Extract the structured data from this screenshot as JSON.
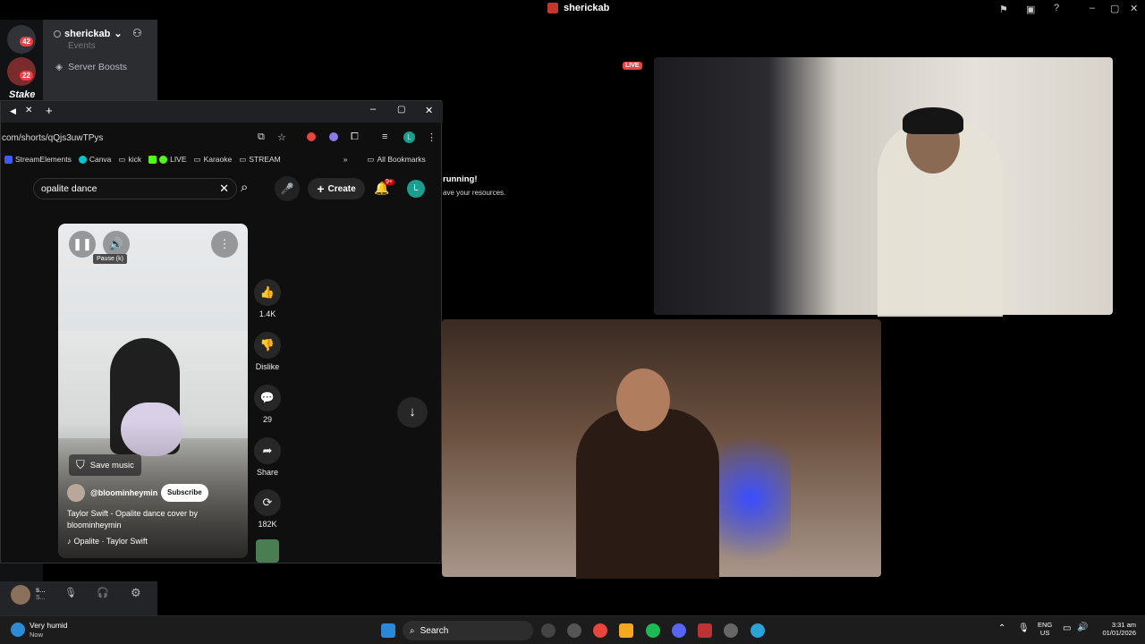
{
  "window": {
    "title": "sherickab"
  },
  "discord": {
    "server_badges": [
      "42",
      "22"
    ],
    "server_logo_text": "Stake",
    "user_name": "sherickab",
    "channels": [
      "Events",
      "Server Boosts"
    ],
    "live_badge": "LIVE",
    "notice_title": "running!",
    "notice_text": "ave your resources.",
    "user_panel": {
      "name": "s...",
      "status": "S..."
    }
  },
  "browser": {
    "url": "com/shorts/qQjs3uwTPys",
    "bookmarks": [
      {
        "label": "StreamElements",
        "color": "#3d5afe"
      },
      {
        "label": "Canva",
        "color": "#00c4cc"
      },
      {
        "label": "kick",
        "color": "#888888"
      },
      {
        "label": "LIVE",
        "color": "#53fc18"
      },
      {
        "label": "Karaoke",
        "color": "#888888"
      },
      {
        "label": "STREAM",
        "color": "#888888"
      }
    ],
    "all_bookmarks": "All Bookmarks",
    "profile_initial": "L"
  },
  "youtube": {
    "search_value": "opalite dance",
    "create_label": "Create",
    "notif_badge": "9+",
    "avatar_initial": "L",
    "tooltip": "Pause (k)",
    "save_music": "Save music",
    "channel": "@bloominheymin",
    "subscribe": "Subscribe",
    "title": "Taylor Swift - Opalite dance cover by bloominheymin",
    "music": "Opalite · Taylor Swift",
    "likes": "1.4K",
    "dislike": "Dislike",
    "comments": "29",
    "share": "Share",
    "remix": "182K"
  },
  "taskbar": {
    "weather_title": "Very humid",
    "weather_sub": "Now",
    "search": "Search",
    "lang": "ENG",
    "region": "US",
    "time": "3:31 am",
    "date": "01/01/2026"
  }
}
